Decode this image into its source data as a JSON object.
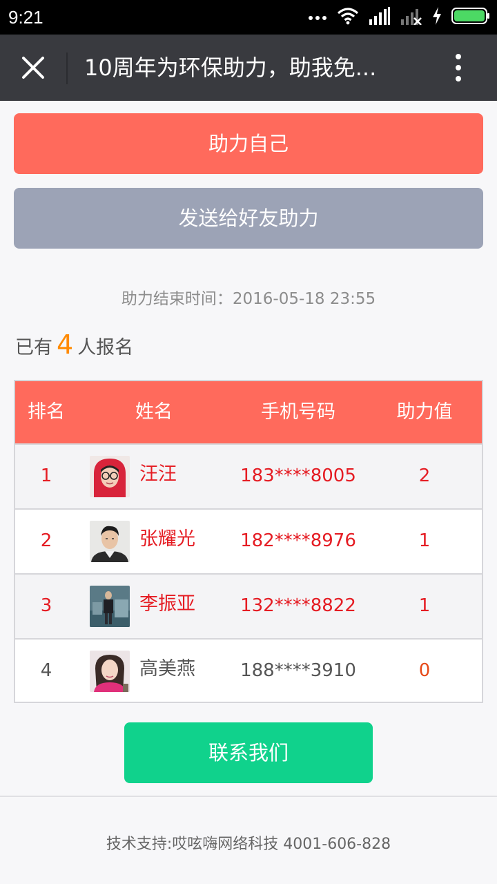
{
  "status_bar": {
    "time": "9:21",
    "icons": [
      "more-dots-icon",
      "wifi-icon",
      "signal-icon",
      "signal-no-service-icon",
      "charging-icon",
      "battery-icon"
    ]
  },
  "nav": {
    "close_icon": "close-icon",
    "title": "10周年为环保助力，助我免...",
    "more_icon": "more-vertical-icon"
  },
  "buttons": {
    "help_self": "助力自己",
    "send_friend": "发送给好友助力",
    "contact": "联系我们"
  },
  "end_time": "助力结束时间：2016-05-18 23:55",
  "signup": {
    "prefix": "已有",
    "count": "4",
    "suffix": "人报名"
  },
  "table": {
    "headers": [
      "排名",
      "姓名",
      "手机号码",
      "助力值"
    ],
    "rows": [
      {
        "rank": "1",
        "name": "汪汪",
        "phone": "183****8005",
        "value": "2"
      },
      {
        "rank": "2",
        "name": "张耀光",
        "phone": "182****8976",
        "value": "1"
      },
      {
        "rank": "3",
        "name": "李振亚",
        "phone": "132****8822",
        "value": "1"
      },
      {
        "rank": "4",
        "name": "高美燕",
        "phone": "188****3910",
        "value": "0"
      }
    ]
  },
  "footer": "技术支持:哎呟嗨网络科技 4001-606-828",
  "colors": {
    "primary_red": "#ff6a5c",
    "share_gray": "#9ca3b6",
    "contact_green": "#10d28c",
    "count_orange": "#ff8a00",
    "text_red": "#e51c23"
  }
}
